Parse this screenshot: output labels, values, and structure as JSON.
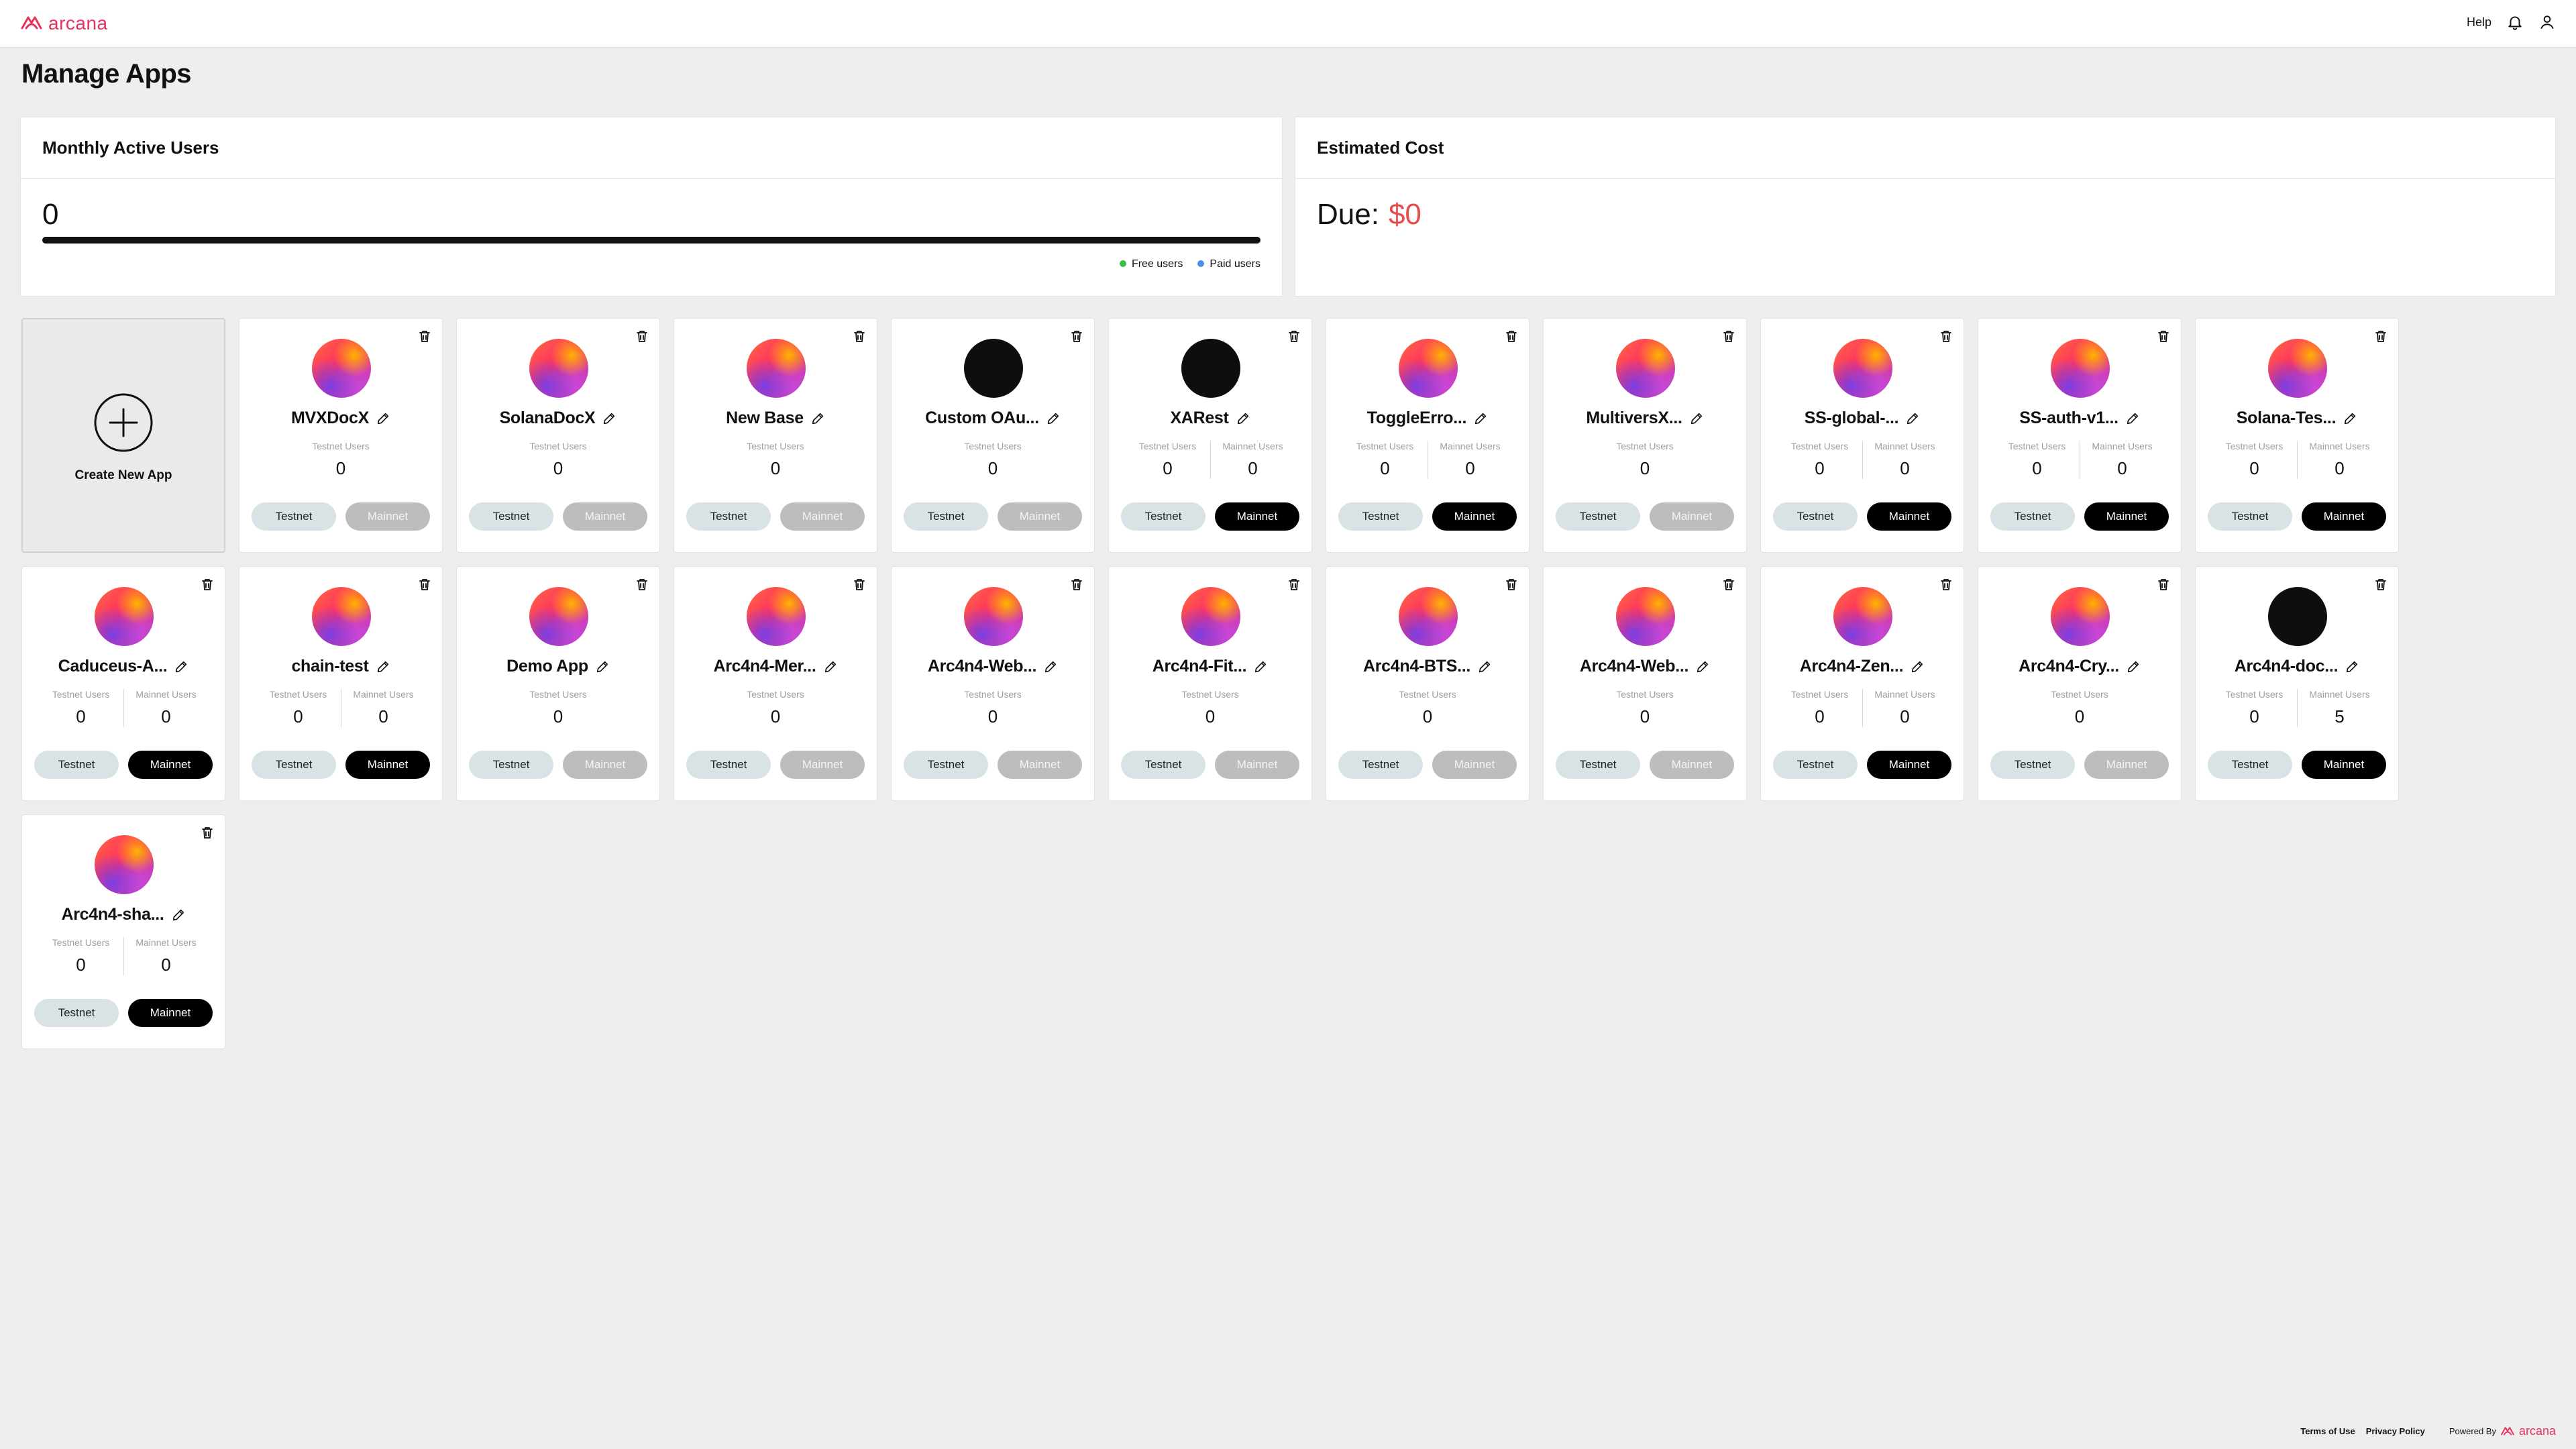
{
  "header": {
    "brand": "arcana",
    "help": "Help",
    "bell_icon": "bell-icon",
    "user_icon": "user-icon"
  },
  "page_title": "Manage Apps",
  "mau": {
    "title": "Monthly Active Users",
    "count": "0",
    "legend": [
      {
        "label": "Free users",
        "color": "#3bbd4a"
      },
      {
        "label": "Paid users",
        "color": "#4b8de8"
      }
    ]
  },
  "cost": {
    "title": "Estimated Cost",
    "due_label": "Due:",
    "due_amount": "$0"
  },
  "create_label": "Create New App",
  "labels": {
    "testnet_users": "Testnet Users",
    "mainnet_users": "Mainnet Users",
    "testnet": "Testnet",
    "mainnet": "Mainnet"
  },
  "apps": [
    {
      "name": "MVXDocX",
      "avatar": "gradient",
      "testnet": "0",
      "mainnet": null
    },
    {
      "name": "SolanaDocX",
      "avatar": "gradient",
      "testnet": "0",
      "mainnet": null
    },
    {
      "name": "New Base",
      "avatar": "gradient",
      "testnet": "0",
      "mainnet": null
    },
    {
      "name": "Custom OAu...",
      "avatar": "dark",
      "testnet": "0",
      "mainnet": null
    },
    {
      "name": "XARest",
      "avatar": "dark",
      "testnet": "0",
      "mainnet": "0"
    },
    {
      "name": "ToggleErro...",
      "avatar": "gradient",
      "testnet": "0",
      "mainnet": "0"
    },
    {
      "name": "MultiversX...",
      "avatar": "gradient",
      "testnet": "0",
      "mainnet": null
    },
    {
      "name": "SS-global-...",
      "avatar": "gradient",
      "testnet": "0",
      "mainnet": "0"
    },
    {
      "name": "SS-auth-v1...",
      "avatar": "gradient",
      "testnet": "0",
      "mainnet": "0"
    },
    {
      "name": "Solana-Tes...",
      "avatar": "gradient",
      "testnet": "0",
      "mainnet": "0"
    },
    {
      "name": "Caduceus-A...",
      "avatar": "gradient",
      "testnet": "0",
      "mainnet": "0"
    },
    {
      "name": "chain-test",
      "avatar": "gradient",
      "testnet": "0",
      "mainnet": "0"
    },
    {
      "name": "Demo App",
      "avatar": "gradient",
      "testnet": "0",
      "mainnet": null
    },
    {
      "name": "Arc4n4-Mer...",
      "avatar": "gradient",
      "testnet": "0",
      "mainnet": null
    },
    {
      "name": "Arc4n4-Web...",
      "avatar": "gradient",
      "testnet": "0",
      "mainnet": null
    },
    {
      "name": "Arc4n4-Fit...",
      "avatar": "gradient",
      "testnet": "0",
      "mainnet": null
    },
    {
      "name": "Arc4n4-BTS...",
      "avatar": "gradient",
      "testnet": "0",
      "mainnet": null
    },
    {
      "name": "Arc4n4-Web...",
      "avatar": "gradient",
      "testnet": "0",
      "mainnet": null
    },
    {
      "name": "Arc4n4-Zen...",
      "avatar": "gradient",
      "testnet": "0",
      "mainnet": "0"
    },
    {
      "name": "Arc4n4-Cry...",
      "avatar": "gradient",
      "testnet": "0",
      "mainnet": null
    },
    {
      "name": "Arc4n4-doc...",
      "avatar": "dark",
      "testnet": "0",
      "mainnet": "5"
    },
    {
      "name": "Arc4n4-sha...",
      "avatar": "gradient",
      "testnet": "0",
      "mainnet": "0"
    }
  ],
  "footer": {
    "terms": "Terms of Use",
    "privacy": "Privacy Policy",
    "powered_by": "Powered By",
    "brand": "arcana"
  }
}
